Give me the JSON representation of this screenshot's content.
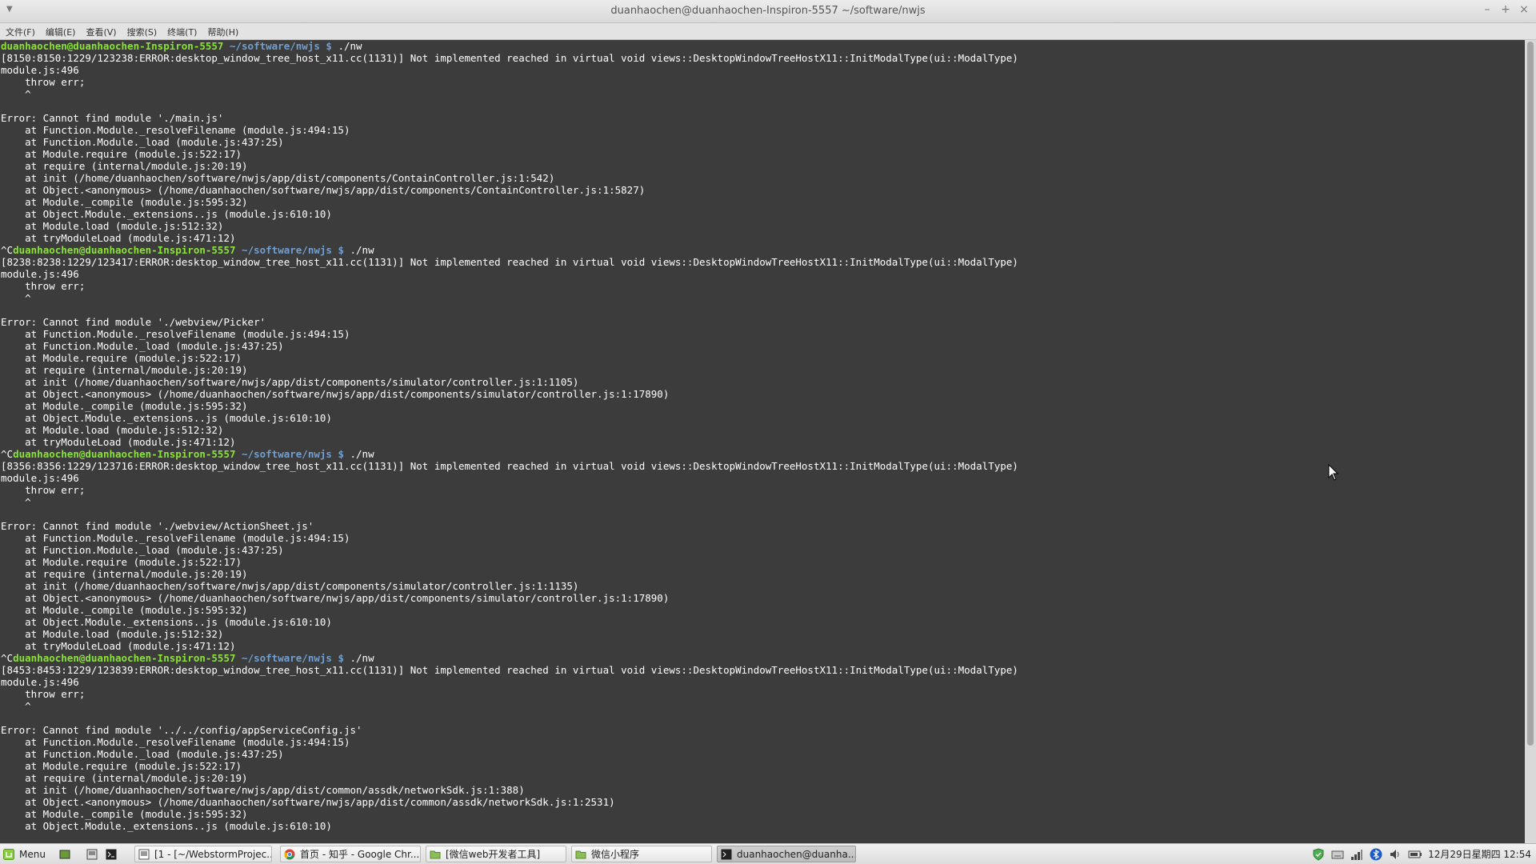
{
  "window": {
    "title": "duanhaochen@duanhaochen-Inspiron-5557 ~/software/nwjs",
    "controls": [
      "–",
      "+",
      "×"
    ]
  },
  "menubar": [
    "文件(F)",
    "编辑(E)",
    "查看(V)",
    "搜索(S)",
    "终端(T)",
    "帮助(H)"
  ],
  "terminal": {
    "lines": [
      {
        "user": "duanhaochen@duanhaochen-Inspiron-5557",
        "path": " ~/software/nwjs $",
        "cmd": " ./nw"
      },
      {
        "text": "[8150:8150:1229/123238:ERROR:desktop_window_tree_host_x11.cc(1131)] Not implemented reached in virtual void views::DesktopWindowTreeHostX11::InitModalType(ui::ModalType)"
      },
      {
        "text": "module.js:496"
      },
      {
        "text": "    throw err;"
      },
      {
        "text": "    ^"
      },
      {
        "text": ""
      },
      {
        "text": "Error: Cannot find module './main.js'"
      },
      {
        "text": "    at Function.Module._resolveFilename (module.js:494:15)"
      },
      {
        "text": "    at Function.Module._load (module.js:437:25)"
      },
      {
        "text": "    at Module.require (module.js:522:17)"
      },
      {
        "text": "    at require (internal/module.js:20:19)"
      },
      {
        "text": "    at init (/home/duanhaochen/software/nwjs/app/dist/components/ContainController.js:1:542)"
      },
      {
        "text": "    at Object.<anonymous> (/home/duanhaochen/software/nwjs/app/dist/components/ContainController.js:1:5827)"
      },
      {
        "text": "    at Module._compile (module.js:595:32)"
      },
      {
        "text": "    at Object.Module._extensions..js (module.js:610:10)"
      },
      {
        "text": "    at Module.load (module.js:512:32)"
      },
      {
        "text": "    at tryModuleLoad (module.js:471:12)"
      },
      {
        "prefix": "^C",
        "user": "duanhaochen@duanhaochen-Inspiron-5557",
        "path": " ~/software/nwjs $",
        "cmd": " ./nw"
      },
      {
        "text": "[8238:8238:1229/123417:ERROR:desktop_window_tree_host_x11.cc(1131)] Not implemented reached in virtual void views::DesktopWindowTreeHostX11::InitModalType(ui::ModalType)"
      },
      {
        "text": "module.js:496"
      },
      {
        "text": "    throw err;"
      },
      {
        "text": "    ^"
      },
      {
        "text": ""
      },
      {
        "text": "Error: Cannot find module './webview/Picker'"
      },
      {
        "text": "    at Function.Module._resolveFilename (module.js:494:15)"
      },
      {
        "text": "    at Function.Module._load (module.js:437:25)"
      },
      {
        "text": "    at Module.require (module.js:522:17)"
      },
      {
        "text": "    at require (internal/module.js:20:19)"
      },
      {
        "text": "    at init (/home/duanhaochen/software/nwjs/app/dist/components/simulator/controller.js:1:1105)"
      },
      {
        "text": "    at Object.<anonymous> (/home/duanhaochen/software/nwjs/app/dist/components/simulator/controller.js:1:17890)"
      },
      {
        "text": "    at Module._compile (module.js:595:32)"
      },
      {
        "text": "    at Object.Module._extensions..js (module.js:610:10)"
      },
      {
        "text": "    at Module.load (module.js:512:32)"
      },
      {
        "text": "    at tryModuleLoad (module.js:471:12)"
      },
      {
        "prefix": "^C",
        "user": "duanhaochen@duanhaochen-Inspiron-5557",
        "path": " ~/software/nwjs $",
        "cmd": " ./nw"
      },
      {
        "text": "[8356:8356:1229/123716:ERROR:desktop_window_tree_host_x11.cc(1131)] Not implemented reached in virtual void views::DesktopWindowTreeHostX11::InitModalType(ui::ModalType)"
      },
      {
        "text": "module.js:496"
      },
      {
        "text": "    throw err;"
      },
      {
        "text": "    ^"
      },
      {
        "text": ""
      },
      {
        "text": "Error: Cannot find module './webview/ActionSheet.js'"
      },
      {
        "text": "    at Function.Module._resolveFilename (module.js:494:15)"
      },
      {
        "text": "    at Function.Module._load (module.js:437:25)"
      },
      {
        "text": "    at Module.require (module.js:522:17)"
      },
      {
        "text": "    at require (internal/module.js:20:19)"
      },
      {
        "text": "    at init (/home/duanhaochen/software/nwjs/app/dist/components/simulator/controller.js:1:1135)"
      },
      {
        "text": "    at Object.<anonymous> (/home/duanhaochen/software/nwjs/app/dist/components/simulator/controller.js:1:17890)"
      },
      {
        "text": "    at Module._compile (module.js:595:32)"
      },
      {
        "text": "    at Object.Module._extensions..js (module.js:610:10)"
      },
      {
        "text": "    at Module.load (module.js:512:32)"
      },
      {
        "text": "    at tryModuleLoad (module.js:471:12)"
      },
      {
        "prefix": "^C",
        "user": "duanhaochen@duanhaochen-Inspiron-5557",
        "path": " ~/software/nwjs $",
        "cmd": " ./nw"
      },
      {
        "text": "[8453:8453:1229/123839:ERROR:desktop_window_tree_host_x11.cc(1131)] Not implemented reached in virtual void views::DesktopWindowTreeHostX11::InitModalType(ui::ModalType)"
      },
      {
        "text": "module.js:496"
      },
      {
        "text": "    throw err;"
      },
      {
        "text": "    ^"
      },
      {
        "text": ""
      },
      {
        "text": "Error: Cannot find module '../../config/appServiceConfig.js'"
      },
      {
        "text": "    at Function.Module._resolveFilename (module.js:494:15)"
      },
      {
        "text": "    at Function.Module._load (module.js:437:25)"
      },
      {
        "text": "    at Module.require (module.js:522:17)"
      },
      {
        "text": "    at require (internal/module.js:20:19)"
      },
      {
        "text": "    at init (/home/duanhaochen/software/nwjs/app/dist/common/assdk/networkSdk.js:1:388)"
      },
      {
        "text": "    at Object.<anonymous> (/home/duanhaochen/software/nwjs/app/dist/common/assdk/networkSdk.js:1:2531)"
      },
      {
        "text": "    at Module._compile (module.js:595:32)"
      },
      {
        "text": "    at Object.Module._extensions..js (module.js:610:10)"
      }
    ]
  },
  "taskbar": {
    "menu_label": "Menu",
    "windows": [
      {
        "label": "[1 - [~/WebstormProjec...",
        "icon": "webstorm-icon",
        "active": false
      },
      {
        "label": "首页 - 知乎 - Google Chr...",
        "icon": "chrome-icon",
        "active": false
      },
      {
        "label": "[微信web开发者工具]",
        "icon": "folder-icon",
        "active": false
      },
      {
        "label": "微信小程序",
        "icon": "folder-icon",
        "active": false
      },
      {
        "label": "duanhaochen@duanha...",
        "icon": "terminal-icon",
        "active": true
      }
    ],
    "clock": "12月29日星期四 12:54",
    "colors": {
      "prompt_user": "#8ae234",
      "prompt_path": "#729fcf",
      "terminal_bg": "#3c3c3c"
    }
  }
}
